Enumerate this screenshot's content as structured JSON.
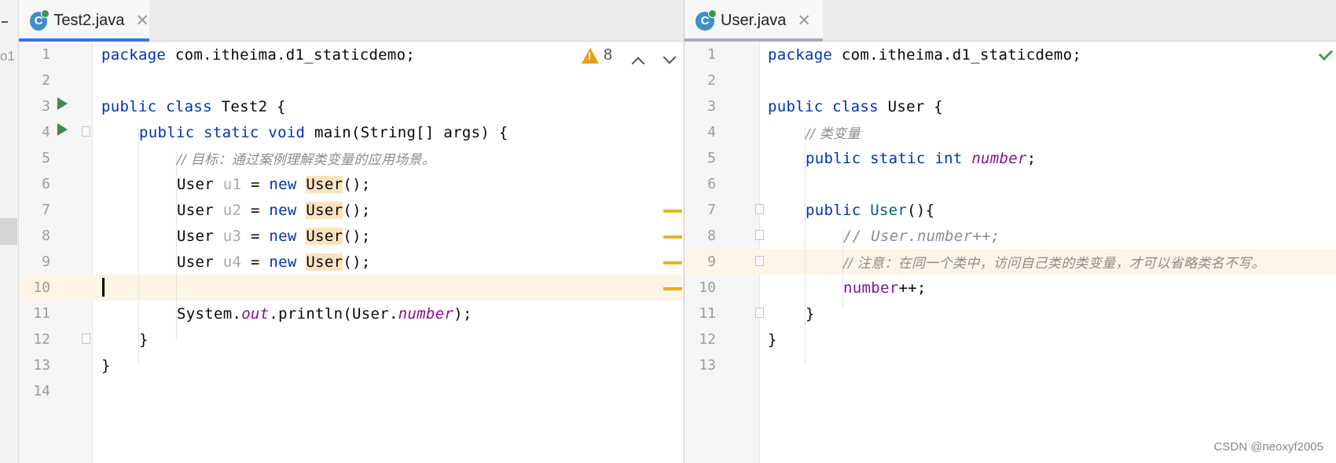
{
  "left_editor": {
    "tab": {
      "label": "Test2.java",
      "icon": "java-class-icon",
      "close": "✕",
      "active_color": "#3574f0"
    },
    "inspection": {
      "warning_count": "8",
      "icon": "warning-icon"
    },
    "lines": [
      {
        "num": "1"
      },
      {
        "num": "2"
      },
      {
        "num": "3"
      },
      {
        "num": "4"
      },
      {
        "num": "5"
      },
      {
        "num": "6"
      },
      {
        "num": "7"
      },
      {
        "num": "8"
      },
      {
        "num": "9"
      },
      {
        "num": "10"
      },
      {
        "num": "11"
      },
      {
        "num": "12"
      },
      {
        "num": "13"
      },
      {
        "num": "14"
      }
    ],
    "code": {
      "l1_kw": "package",
      "l1_rest": " com.itheima.d1_staticdemo;",
      "l3_kw": "public class",
      "l3_rest": " Test2 {",
      "l4_kw": "public static void",
      "l4_rest": " main(String[] args) {",
      "l5_cmt": "// 目标：通过案例理解类变量的应用场景。",
      "user_type": "User",
      "assign": " = ",
      "new_kw": "new",
      "ctor": "User",
      "ctor_end": "();",
      "vars": [
        "u1",
        "u2",
        "u3",
        "u4"
      ],
      "l11_a": "System.",
      "l11_out": "out",
      "l11_b": ".println(User.",
      "l11_fld": "number",
      "l11_c": ");",
      "l12": "}",
      "l13": "}"
    }
  },
  "right_editor": {
    "tab": {
      "label": "User.java",
      "icon": "java-class-icon",
      "close": "✕",
      "active_color": "#a8adbd"
    },
    "lines": [
      {
        "num": "1"
      },
      {
        "num": "2"
      },
      {
        "num": "3"
      },
      {
        "num": "4"
      },
      {
        "num": "5"
      },
      {
        "num": "6"
      },
      {
        "num": "7"
      },
      {
        "num": "8"
      },
      {
        "num": "9"
      },
      {
        "num": "10"
      },
      {
        "num": "11"
      },
      {
        "num": "12"
      },
      {
        "num": "13"
      }
    ],
    "code": {
      "l1_kw": "package",
      "l1_rest": " com.itheima.d1_staticdemo;",
      "l3_kw": "public class",
      "l3_rest": " User {",
      "l4_cmt": "// 类变量",
      "l5_kw": "public static int",
      "l5_fld": "number",
      "l5_end": ";",
      "l7_kw": "public",
      "l7_ctor": "User",
      "l7_end": "(){",
      "l8_cmt": "// User.number++;",
      "l9_cmt": "// 注意：在同一个类中，访问自己类的类变量，才可以省略类名不写。",
      "l10_fld": "number",
      "l10_end": "++;",
      "l11": "}",
      "l12": "}"
    }
  },
  "edge": {
    "cut_text": "o1"
  },
  "watermark": "CSDN @neoxyf2005",
  "colors": {
    "keyword": "#0033b3",
    "comment": "#8c8c8c",
    "field": "#871094",
    "highlight": "#fbe3bf",
    "warning": "#e2a213",
    "run": "#3c8c4a"
  }
}
